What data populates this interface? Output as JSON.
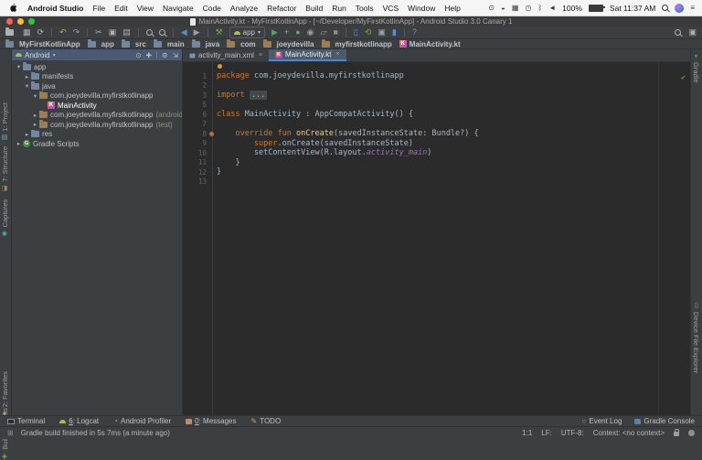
{
  "window": {
    "title": "MainActivity.kt - MyFirstKotlinApp - [~/Developer/MyFirstKotlinApp] - Android Studio 3.0 Canary 1"
  },
  "menubar": {
    "items": [
      "Android Studio",
      "File",
      "Edit",
      "View",
      "Navigate",
      "Code",
      "Analyze",
      "Refactor",
      "Build",
      "Run",
      "Tools",
      "VCS",
      "Window",
      "Help"
    ],
    "status_icons": [
      {
        "name": "app-status-icon-1",
        "glyph": "⊙"
      },
      {
        "name": "app-status-icon-2",
        "glyph": "◒"
      },
      {
        "name": "display-status-icon",
        "glyph": "▦"
      },
      {
        "name": "time-machine-status-icon",
        "glyph": "◷"
      },
      {
        "name": "bluetooth-status-icon",
        "glyph": "ᛒ"
      },
      {
        "name": "volume-status-icon",
        "glyph": "◄"
      }
    ],
    "battery": "100%",
    "clock": "Sat 11:37 AM"
  },
  "toolbar": {
    "run_config": "app",
    "items": [
      {
        "name": "open-icon",
        "icon": "folder-css",
        "color": "#AFB1B3"
      },
      {
        "name": "save-all-icon",
        "glyph": "▦",
        "color": "#AFB1B3"
      },
      {
        "name": "sync-icon",
        "glyph": "⟳",
        "color": "#AFB1B3"
      },
      {
        "sep": true
      },
      {
        "name": "undo-icon",
        "glyph": "↶",
        "color": "#C9A356"
      },
      {
        "name": "redo-icon",
        "glyph": "↷",
        "color": "#9DA0A3"
      },
      {
        "sep": true
      },
      {
        "name": "cut-icon",
        "glyph": "✂",
        "color": "#AFB1B3"
      },
      {
        "name": "copy-icon",
        "glyph": "▣",
        "color": "#AFB1B3"
      },
      {
        "name": "paste-icon",
        "glyph": "▤",
        "color": "#AFB1B3"
      },
      {
        "sep": true
      },
      {
        "name": "find-icon",
        "icon": "mag",
        "color": "#AFB1B3"
      },
      {
        "name": "replace-icon",
        "icon": "mag",
        "color": "#AFB1B3"
      },
      {
        "sep": true
      },
      {
        "name": "back-icon",
        "glyph": "◀",
        "color": "#5B8FC7"
      },
      {
        "name": "forward-icon",
        "glyph": "▶",
        "color": "#9DA0A3"
      },
      {
        "sep": true
      },
      {
        "name": "make-project-icon",
        "glyph": "⚒",
        "color": "#7F9F54"
      },
      {
        "runconfig": true,
        "name": "run-config-selector"
      },
      {
        "name": "run-icon",
        "glyph": "▶",
        "color": "#5F9E5C"
      },
      {
        "name": "apply-changes-icon",
        "glyph": "+",
        "color": "#9DA0A3"
      },
      {
        "name": "debug-icon",
        "glyph": "●",
        "color": "#6FA35F"
      },
      {
        "name": "coverage-icon",
        "glyph": "◉",
        "color": "#9DA0A3"
      },
      {
        "name": "profile-icon",
        "glyph": "▱",
        "color": "#9DA0A3"
      },
      {
        "name": "stop-icon",
        "glyph": "■",
        "color": "#8A8D90"
      },
      {
        "sep": true
      },
      {
        "name": "avd-manager-icon",
        "glyph": "▯",
        "color": "#5B8FC7"
      },
      {
        "name": "sync-gradle-icon",
        "glyph": "⟲",
        "color": "#7F9F54"
      },
      {
        "name": "sdk-manager-icon",
        "glyph": "▣",
        "color": "#9DA0A3"
      },
      {
        "name": "device-monitor-icon",
        "glyph": "▮",
        "color": "#5B8FC7"
      },
      {
        "sep": true
      },
      {
        "name": "help-icon",
        "glyph": "?",
        "color": "#5B8FC7"
      }
    ],
    "right_items": [
      {
        "name": "search-everywhere-icon",
        "icon": "mag",
        "color": "#AFB1B3"
      },
      {
        "name": "switcher-icon",
        "glyph": "▣",
        "color": "#AFB1B3"
      }
    ]
  },
  "breadcrumb": [
    {
      "label": "MyFirstKotlinApp",
      "icon": "folder"
    },
    {
      "label": "app",
      "icon": "folder"
    },
    {
      "label": "src",
      "icon": "folder"
    },
    {
      "label": "main",
      "icon": "folder"
    },
    {
      "label": "java",
      "icon": "folder"
    },
    {
      "label": "com",
      "icon": "package"
    },
    {
      "label": "joeydevilla",
      "icon": "package"
    },
    {
      "label": "myfirstkotlinapp",
      "icon": "package"
    },
    {
      "label": "MainActivity.kt",
      "icon": "kotlin"
    }
  ],
  "strips": {
    "left_top": [
      {
        "label": "1: Project",
        "icon": "project",
        "glyph": "▤",
        "color": "#8FA3B5"
      },
      {
        "label": "7: Structure",
        "icon": "structure",
        "glyph": "◧",
        "color": "#B5885C"
      },
      {
        "label": "Captures",
        "icon": "captures",
        "glyph": "◉",
        "color": "#56A8A0"
      }
    ],
    "left_bottom": [
      {
        "label": "2: Favorites",
        "icon": "favorites",
        "glyph": "★",
        "color": "#C9A356"
      },
      {
        "label": "Build Variants",
        "icon": "build-variants",
        "glyph": "✚",
        "color": "#7F9F54"
      }
    ],
    "right_top": [
      {
        "label": "Gradle",
        "icon": "gradle",
        "glyph": "●",
        "color": "#5E8B50"
      }
    ],
    "right_bottom": [
      {
        "label": "Device File Explorer",
        "icon": "device-file-explorer",
        "glyph": "▯",
        "color": "#9DA0A3"
      }
    ]
  },
  "project": {
    "selector": "Android",
    "actions": [
      {
        "name": "scroll-from-source-icon",
        "glyph": "⊙"
      },
      {
        "name": "collapse-all-icon",
        "glyph": "✚"
      },
      {
        "sep": true
      },
      {
        "name": "settings-icon",
        "glyph": "⚙"
      },
      {
        "name": "hide-panel-icon",
        "glyph": "⇲"
      }
    ],
    "tree": [
      {
        "label": "app",
        "indent": 0,
        "expander": "down",
        "icon": "folder"
      },
      {
        "label": "manifests",
        "indent": 1,
        "expander": "right",
        "icon": "folder"
      },
      {
        "label": "java",
        "indent": 1,
        "expander": "down",
        "icon": "folder"
      },
      {
        "label": "com.joeydevilla.myfirstkotlinapp",
        "indent": 2,
        "expander": "down",
        "icon": "package"
      },
      {
        "label": "MainActivity",
        "indent": 3,
        "expander": "none",
        "icon": "kotlin",
        "selected": true
      },
      {
        "label": "com.joeydevilla.myfirstkotlinapp",
        "suffix": "(androidTe",
        "indent": 2,
        "expander": "right",
        "icon": "package"
      },
      {
        "label": "com.joeydevilla.myfirstkotlinapp",
        "suffix": "(test)",
        "indent": 2,
        "expander": "right",
        "icon": "package"
      },
      {
        "label": "res",
        "indent": 1,
        "expander": "right",
        "icon": "folder"
      },
      {
        "label": "Gradle Scripts",
        "indent": 0,
        "expander": "right",
        "icon": "gradle"
      }
    ]
  },
  "editor": {
    "tabs": [
      {
        "label": "activity_main.xml",
        "icon": "layout",
        "active": false
      },
      {
        "label": "MainActivity.kt",
        "icon": "kotlin",
        "active": true
      }
    ],
    "lines": [
      {
        "num": "1",
        "segments": [
          {
            "t": "package ",
            "c": "kw"
          },
          {
            "t": "com.joeydevilla.myfirstkotlinapp",
            "c": "pl"
          }
        ]
      },
      {
        "num": "2",
        "segments": []
      },
      {
        "num": "3",
        "segments": [
          {
            "t": "import ",
            "c": "kw"
          },
          {
            "t": "...",
            "c": "fold"
          }
        ]
      },
      {
        "num": "5",
        "segments": []
      },
      {
        "num": "6",
        "segments": [
          {
            "t": "class ",
            "c": "kw"
          },
          {
            "t": "MainActivity : AppCompatActivity() {",
            "c": "pl"
          }
        ]
      },
      {
        "num": "7",
        "segments": []
      },
      {
        "num": "8",
        "marker": "override",
        "segments": [
          {
            "t": "    ",
            "c": "pl"
          },
          {
            "t": "override",
            "c": "kw"
          },
          {
            "t": " ",
            "c": "pl"
          },
          {
            "t": "fun",
            "c": "kw"
          },
          {
            "t": " ",
            "c": "pl"
          },
          {
            "t": "onCreate",
            "c": "fn"
          },
          {
            "t": "(savedInstanceState: Bundle?) {",
            "c": "pl"
          }
        ]
      },
      {
        "num": "9",
        "segments": [
          {
            "t": "        ",
            "c": "pl"
          },
          {
            "t": "super",
            "c": "kw"
          },
          {
            "t": ".onCreate(savedInstanceState)",
            "c": "pl"
          }
        ]
      },
      {
        "num": "10",
        "segments": [
          {
            "t": "        setContentView(R.layout.",
            "c": "pl"
          },
          {
            "t": "activity_main",
            "c": "field"
          },
          {
            "t": ")",
            "c": "pl"
          }
        ]
      },
      {
        "num": "11",
        "segments": [
          {
            "t": "    }",
            "c": "pl"
          }
        ]
      },
      {
        "num": "12",
        "segments": [
          {
            "t": "}",
            "c": "pl"
          }
        ]
      },
      {
        "num": "13",
        "segments": []
      }
    ]
  },
  "bottom_bar": {
    "left": [
      {
        "label": "Terminal",
        "icon": "terminal"
      },
      {
        "label": "6: Logcat",
        "icon": "android"
      },
      {
        "label": "Android Profiler",
        "icon": "profiler"
      },
      {
        "label": "0: Messages",
        "icon": "messages"
      },
      {
        "label": "TODO",
        "icon": "todo"
      }
    ],
    "right": [
      {
        "label": "Event Log",
        "icon": "event-log"
      },
      {
        "label": "Gradle Console",
        "icon": "gradle-console"
      }
    ]
  },
  "status_bar": {
    "message": "Gradle build finished in 5s 7ms (a minute ago)",
    "position": "1:1",
    "line_sep": "LF:",
    "encoding": "UTF-8:",
    "context": "Context: <no context>"
  },
  "colors": {
    "selection_blue": "#2E65C9",
    "editor_bg": "#2B2B2B",
    "chrome": "#3C3F41",
    "keyword_orange": "#CC7832",
    "function_yellow": "#FFC66D",
    "field_purple": "#9876AA",
    "folder_blue": "#7387A0",
    "package_tan": "#9C7E52"
  }
}
